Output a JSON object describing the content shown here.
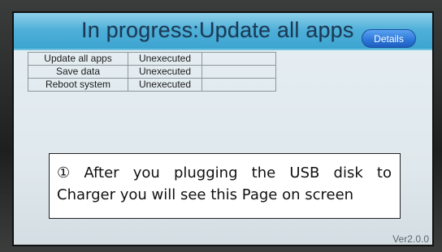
{
  "header": {
    "title": "In progress:Update all apps",
    "details_label": "Details"
  },
  "tasks": [
    {
      "name": "Update all apps",
      "status": "Unexecuted",
      "extra": ""
    },
    {
      "name": "Save data",
      "status": "Unexecuted",
      "extra": ""
    },
    {
      "name": "Reboot system",
      "status": "Unexecuted",
      "extra": ""
    }
  ],
  "note": {
    "marker": "①",
    "words": [
      "After",
      "you",
      "plugging",
      "the",
      "USB",
      "disk",
      "to"
    ],
    "line2": "Charger you will see this Page on screen"
  },
  "version": "Ver2.0.0",
  "colors": {
    "title_bar": "#4fb0d9",
    "details_button": "#2c76d8",
    "content_bg": "#e4edf1"
  }
}
